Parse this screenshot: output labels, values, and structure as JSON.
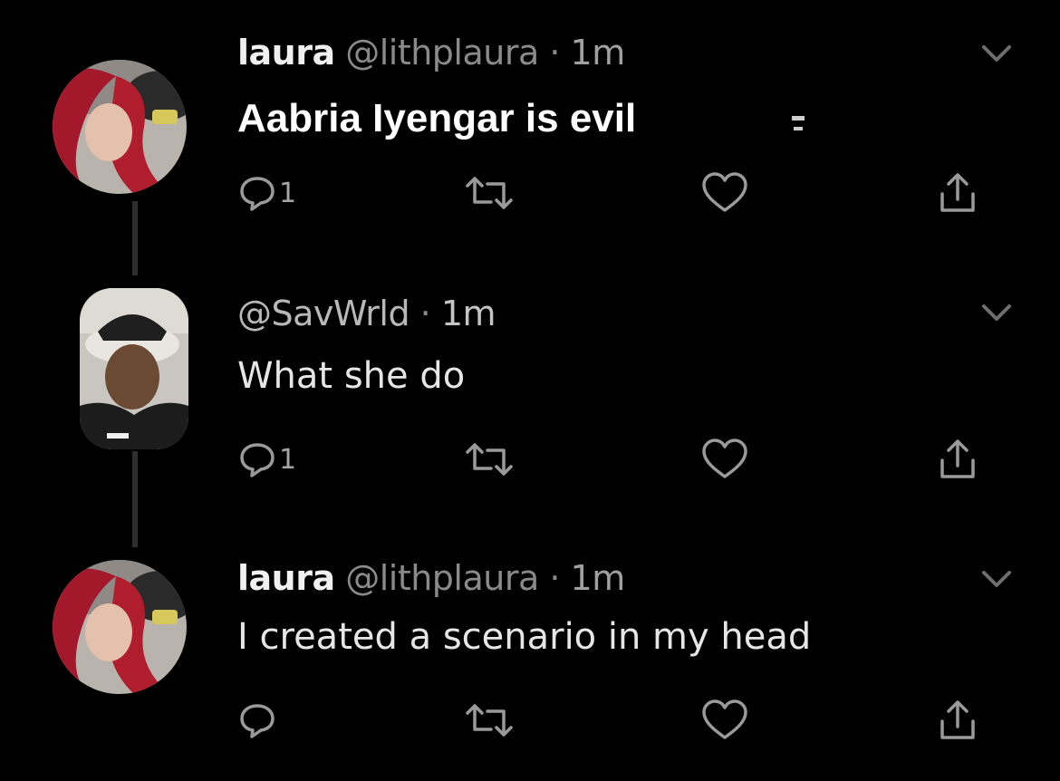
{
  "colors": {
    "background": "#000000",
    "icon": "#9a9a9a",
    "name": "#f0f0f0",
    "handle": "#8a8a8a",
    "body": "#e6e6e6",
    "overlay_text": "#ffffff"
  },
  "tweets": [
    {
      "name": "laura",
      "handle": "@lithplaura",
      "separator": "·",
      "time": "1m",
      "text": "Aabria Iyengar is evil",
      "reply_count": "1",
      "avatar_icon": "avatar-photo"
    },
    {
      "name": "",
      "handle": "@SavWrld",
      "separator": "·",
      "time": "1m",
      "text": "What she do",
      "reply_count": "1",
      "avatar_icon": "avatar-photo"
    },
    {
      "name": "laura",
      "handle": "@lithplaura",
      "separator": "·",
      "time": "1m",
      "text": "I created a scenario in my head",
      "reply_count": "",
      "avatar_icon": "avatar-photo"
    }
  ],
  "icons": {
    "reply": "reply-icon",
    "retweet": "retweet-icon",
    "like": "heart-icon",
    "share": "share-icon",
    "menu": "chevron-down-icon"
  }
}
